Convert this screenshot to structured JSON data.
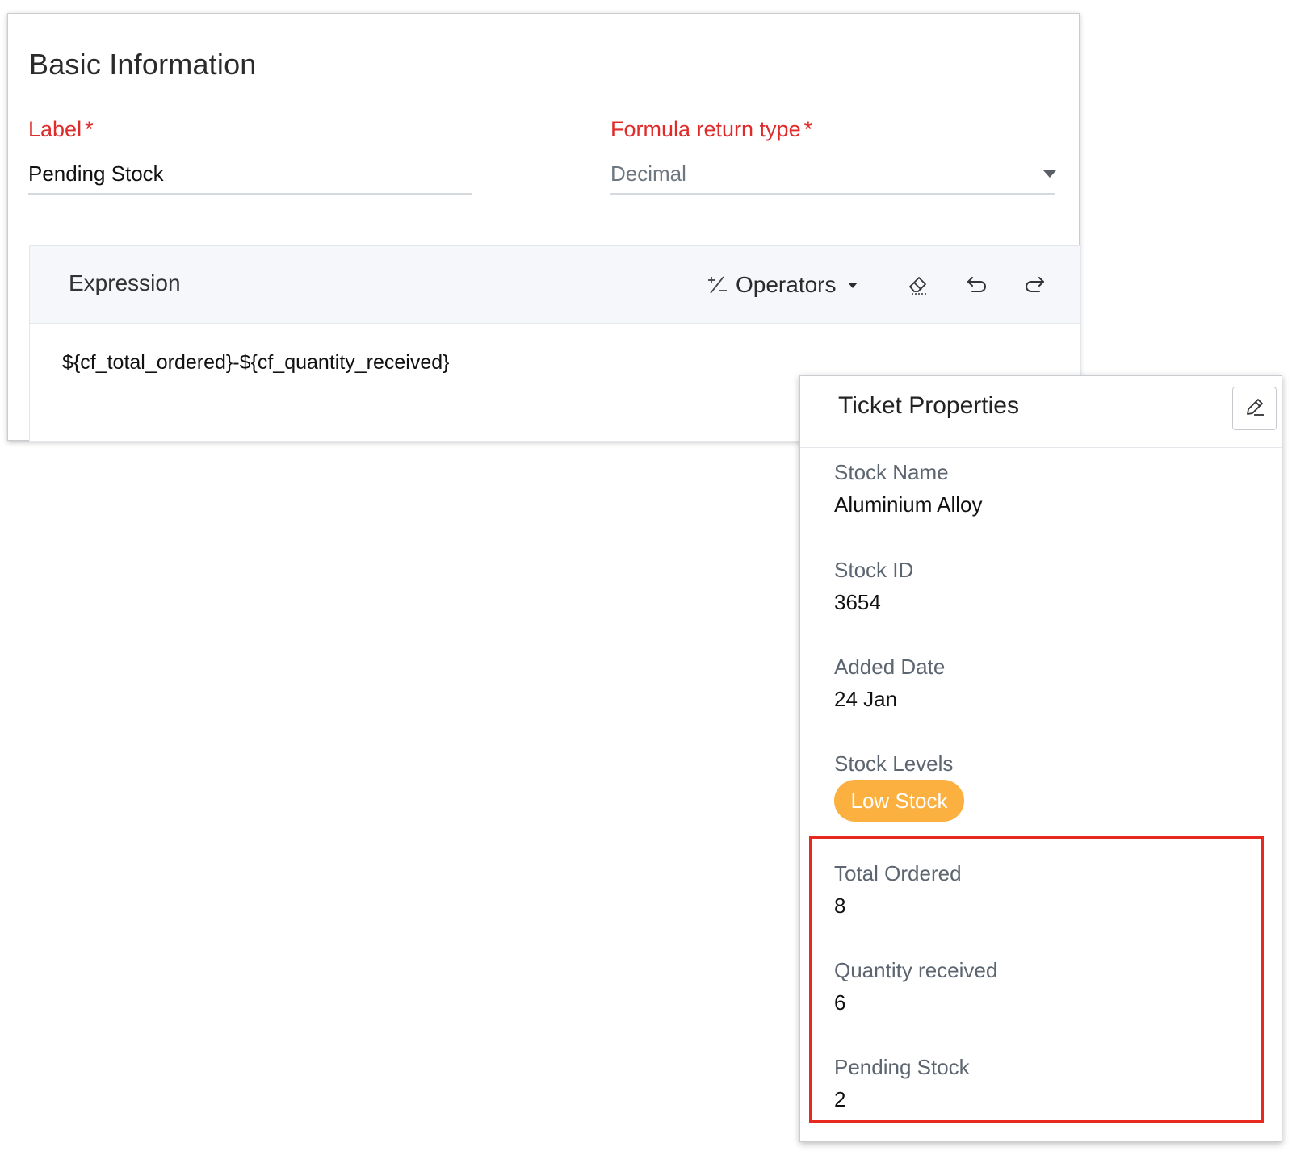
{
  "form": {
    "section_title": "Basic Information",
    "label_field": {
      "label": "Label",
      "required_mark": "*",
      "value": "Pending Stock"
    },
    "return_type_field": {
      "label": "Formula return type",
      "required_mark": "*",
      "value": "Decimal"
    },
    "expression": {
      "title": "Expression",
      "operators_label": "Operators",
      "text": "${cf_total_ordered}-${cf_quantity_received}"
    }
  },
  "ticket": {
    "title": "Ticket Properties",
    "properties": [
      {
        "label": "Stock Name",
        "value": "Aluminium Alloy"
      },
      {
        "label": "Stock ID",
        "value": "3654"
      },
      {
        "label": "Added Date",
        "value": "24 Jan"
      },
      {
        "label": "Stock Levels",
        "value": "Low Stock"
      },
      {
        "label": "Total Ordered",
        "value": "8"
      },
      {
        "label": "Quantity received",
        "value": "6"
      },
      {
        "label": "Pending Stock",
        "value": "2"
      }
    ]
  },
  "colors": {
    "required_label": "#e02b2b",
    "badge_bg": "#fbb040",
    "highlight_border": "#e8291f"
  }
}
